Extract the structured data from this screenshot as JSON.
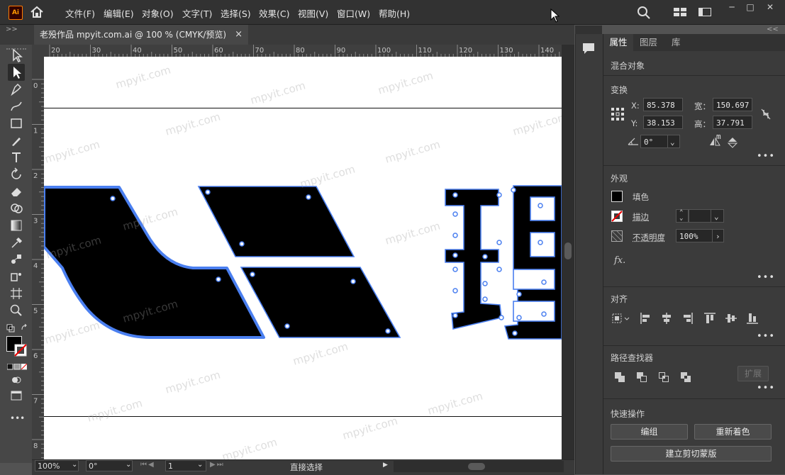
{
  "app": {
    "logo_text": "Ai",
    "accent": "#ff9a00"
  },
  "menu": [
    "文件(F)",
    "编辑(E)",
    "对象(O)",
    "文字(T)",
    "选择(S)",
    "效果(C)",
    "视图(V)",
    "窗口(W)",
    "帮助(H)"
  ],
  "window_controls": {
    "minimize": "─",
    "restore": "□",
    "close": "✕"
  },
  "tab": {
    "title": "老殁作品 mpyit.com.ai @ 100 % (CMYK/预览)",
    "close": "×"
  },
  "ruler_top": [
    "20",
    "30",
    "40",
    "50",
    "60",
    "70",
    "80",
    "90",
    "100",
    "110",
    "120",
    "130",
    "140"
  ],
  "ruler_left": [
    "0",
    "1",
    "2",
    "3",
    "4",
    "5",
    "6",
    "7",
    "8"
  ],
  "status": {
    "zoom": "100%",
    "rotation": "0°",
    "artboard": "1",
    "tool": "直接选择"
  },
  "panel": {
    "tabs": [
      "属性",
      "图层",
      "库"
    ],
    "object_type": "混合对象",
    "transform": {
      "title": "变换",
      "x_label": "X:",
      "x_value": "85.378 m",
      "y_label": "Y:",
      "y_value": "38.153 m",
      "w_label": "宽：",
      "w_value": "150.697",
      "h_label": "高：",
      "h_value": "37.791 m",
      "angle_value": "0°"
    },
    "appearance": {
      "title": "外观",
      "fill_label": "填色",
      "stroke_label": "描边",
      "opacity_label": "不透明度",
      "opacity_value": "100%",
      "fx": "fx."
    },
    "align": {
      "title": "对齐"
    },
    "pathfinder": {
      "title": "路径查找器",
      "expand_label": "扩展"
    },
    "quick_actions": {
      "title": "快速操作",
      "group_label": "编组",
      "recolor_label": "重新着色",
      "clip_mask_label": "建立剪切蒙版"
    },
    "more": "•••"
  },
  "watermark_text": "mpyit.com",
  "colors": {
    "selection": "#4a7ff0",
    "artwork": "#000000"
  }
}
